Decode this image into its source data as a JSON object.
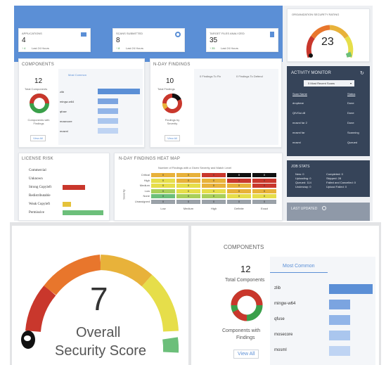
{
  "summary_cards": [
    {
      "label": "APPLICATIONS",
      "value": "4",
      "sub": "Last 24 Hours",
      "delta": "4"
    },
    {
      "label": "SCANS SUBMITTED",
      "value": "8",
      "sub": "Last 24 Hours",
      "delta": "8"
    },
    {
      "label": "TARGET FILES ANALYZED",
      "value": "35",
      "sub": "Last 24 Hours",
      "delta": "35"
    }
  ],
  "org_rating": {
    "title": "ORGANIZATION SECURITY RATING",
    "value": "23"
  },
  "components": {
    "title": "COMPONENTS",
    "total": "12",
    "total_label": "Total Components",
    "donut_label": "Components with Findings",
    "view_all": "View All",
    "tab": "Most Common",
    "items": [
      {
        "name": "zlib",
        "value": 1.0,
        "color": "#5b8fd6"
      },
      {
        "name": "mingw-w64",
        "value": 0.48,
        "color": "#7ba4e0"
      },
      {
        "name": "qfuse",
        "value": 0.48,
        "color": "#92b5e8"
      },
      {
        "name": "mosecore",
        "value": 0.48,
        "color": "#aac6ee"
      },
      {
        "name": "mosml",
        "value": 0.48,
        "color": "#bfd4f3"
      }
    ]
  },
  "nday": {
    "title": "N-DAY FINDINGS",
    "total": "10",
    "total_label": "Total Findings",
    "donut_label": "Findings by Severity",
    "view_all": "View All",
    "tab_fix": "0 Findings To Fix",
    "tab_defend": "0 Findings To Defend"
  },
  "activity": {
    "title": "ACTIVITY MONITOR",
    "select": "5 Most Recent Scans",
    "col_name": "Scan Name",
    "col_status": "Status",
    "rows": [
      {
        "name": "dropbear",
        "status": "Done"
      },
      {
        "name": "QtVGui.dll",
        "status": "Done"
      },
      {
        "name": "mosml far 2",
        "status": "Done"
      },
      {
        "name": "mosml far",
        "status": "Scanning"
      },
      {
        "name": "mosml",
        "status": "Queued"
      }
    ]
  },
  "job_stats": {
    "title": "JOB STATS",
    "left": [
      "New: 0",
      "Uploading: 0",
      "Queued: 114",
      "Underway: 0"
    ],
    "right": [
      "Completed: 0",
      "Skipped: 28",
      "Failed and Cancelled: 0",
      "Upload Failed: 0"
    ]
  },
  "last_updated": {
    "title": "LAST UPDATED"
  },
  "license": {
    "title": "LICENSE RISK",
    "items": [
      {
        "name": "Commercial",
        "value": 0,
        "color": "#c9372c"
      },
      {
        "name": "Unknown",
        "value": 0,
        "color": "#c9372c"
      },
      {
        "name": "Strong Copyleft",
        "value": 0.55,
        "color": "#c9372c"
      },
      {
        "name": "Redistributable",
        "value": 0,
        "color": "#e5c23a"
      },
      {
        "name": "Weak Copyleft",
        "value": 0.2,
        "color": "#e5c23a"
      },
      {
        "name": "Permissive",
        "value": 1.0,
        "color": "#6cbf7a"
      }
    ]
  },
  "heatmap": {
    "title": "N-DAY FINDINGS HEAT MAP",
    "subtitle": "Number of Findings with a Given Severity and Match Level",
    "ylabel": "Severity",
    "rows": [
      "Critical",
      "High",
      "Medium",
      "Low",
      "None",
      "Unassigned"
    ],
    "cols": [
      "Low",
      "Medium",
      "High",
      "Definite",
      "Exact"
    ],
    "values": [
      [
        "0",
        "0",
        "0",
        "0",
        "0"
      ],
      [
        "0",
        "0",
        "0",
        "0",
        "0"
      ],
      [
        "0",
        "0",
        "0",
        "0",
        "0"
      ],
      [
        "0",
        "0",
        "0",
        "0",
        "0"
      ],
      [
        "0",
        "0",
        "0",
        "0",
        "0"
      ],
      [
        "0",
        "0",
        "0",
        "0",
        "0"
      ]
    ],
    "colors": [
      "#c9372c",
      "#e8b23a",
      "#e6de4a",
      "#a9cf5a",
      "#6cbf7a",
      "#9aa1a8"
    ]
  },
  "overall": {
    "value": "7",
    "line1": "Overall",
    "line2": "Security Score"
  },
  "components_zoom": {
    "title": "COMPONENTS",
    "total": "12",
    "total_label": "Total Components",
    "donut_label1": "Components with",
    "donut_label2": "Findings",
    "view_all": "View All",
    "tab": "Most Common",
    "items": [
      {
        "name": "zlib",
        "value": 1.0,
        "color": "#5b8fd6"
      },
      {
        "name": "mingw-w64",
        "value": 0.48,
        "color": "#7ba4e0"
      },
      {
        "name": "qfuse",
        "value": 0.48,
        "color": "#92b5e8"
      },
      {
        "name": "mosecore",
        "value": 0.48,
        "color": "#aac6ee"
      },
      {
        "name": "mosml",
        "value": 0.48,
        "color": "#bfd4f3"
      }
    ]
  }
}
